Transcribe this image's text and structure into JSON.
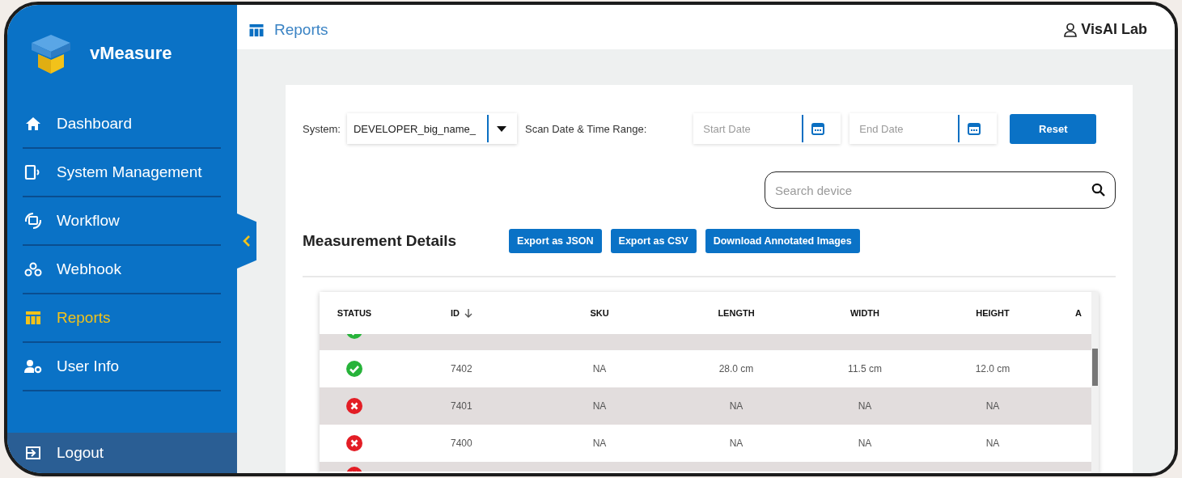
{
  "app": {
    "name": "vMeasure"
  },
  "sidebar": {
    "items": [
      {
        "label": "Dashboard",
        "selected": false
      },
      {
        "label": "System Management",
        "selected": false
      },
      {
        "label": "Workflow",
        "selected": false
      },
      {
        "label": "Webhook",
        "selected": false
      },
      {
        "label": "Reports",
        "selected": true
      },
      {
        "label": "User Info",
        "selected": false
      }
    ],
    "logout": {
      "label": "Logout"
    }
  },
  "header": {
    "title": "Reports",
    "user": "VisAI Lab"
  },
  "filters": {
    "system_label": "System:",
    "system_value": "DEVELOPER_big_name_",
    "range_label": "Scan Date & Time Range:",
    "start_placeholder": "Start Date",
    "end_placeholder": "End Date",
    "reset": "Reset"
  },
  "search": {
    "placeholder": "Search device"
  },
  "section_title": "Measurement Details",
  "actions": [
    "Export as JSON",
    "Export as CSV",
    "Download Annotated Images"
  ],
  "table": {
    "columns": [
      {
        "label": "STATUS"
      },
      {
        "label": "ID",
        "sorted": true
      },
      {
        "label": "SKU"
      },
      {
        "label": "LENGTH"
      },
      {
        "label": "WIDTH"
      },
      {
        "label": "HEIGHT"
      },
      {
        "label": "A"
      }
    ],
    "rows": [
      {
        "kind": "ok"
      },
      {
        "kind": "ok",
        "cells": [
          "7402",
          "NA",
          "28.0 cm",
          "11.5 cm",
          "12.0 cm"
        ]
      },
      {
        "kind": "failed",
        "cells": [
          "7401",
          "NA",
          "NA",
          "NA",
          "NA"
        ]
      },
      {
        "kind": "failed",
        "cells": [
          "7400",
          "NA",
          "NA",
          "NA",
          "NA"
        ]
      },
      {
        "kind": "failed"
      }
    ]
  }
}
